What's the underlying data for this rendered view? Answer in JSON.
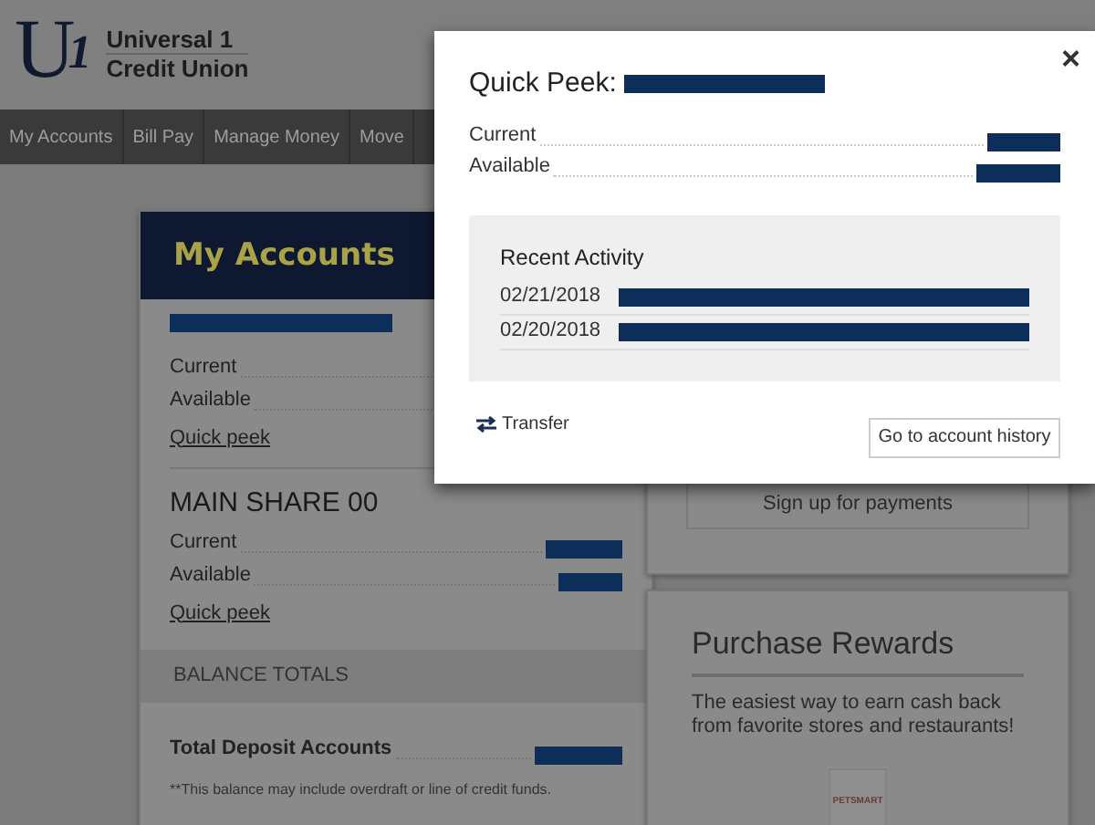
{
  "logo": {
    "mark": "U",
    "mark_sub": "1",
    "line_1": "Universal 1",
    "line_2": "Credit Union"
  },
  "nav": [
    {
      "label": "My Accounts"
    },
    {
      "label": "Bill Pay"
    },
    {
      "label": "Manage Money"
    },
    {
      "label": "Move"
    }
  ],
  "accounts_card": {
    "title": "My Accounts",
    "accounts": [
      {
        "rows": [
          {
            "label": "Current"
          },
          {
            "label": "Available"
          }
        ],
        "link": "Quick peek"
      },
      {
        "name": "MAIN SHARE  00",
        "rows": [
          {
            "label": "Current"
          },
          {
            "label": "Available"
          }
        ],
        "link": "Quick peek"
      }
    ],
    "totals_heading": "BALANCE TOTALS",
    "total_label": "Total Deposit Accounts",
    "footnote": "**This balance may include overdraft or line of credit funds."
  },
  "bill_pay_card": {
    "button": "Sign up for payments"
  },
  "rewards_card": {
    "title": "Purchase Rewards",
    "text": "The easiest way to earn cash back from favorite stores and restaurants!",
    "merchant_logo": "PETSMART"
  },
  "modal": {
    "title": "Quick Peek:",
    "close": "×",
    "rows": [
      {
        "label": "Current"
      },
      {
        "label": "Available"
      }
    ],
    "activity_title": "Recent Activity",
    "activity": [
      {
        "date": "02/21/2018"
      },
      {
        "date": "02/20/2018"
      }
    ],
    "transfer": "Transfer",
    "history_button": "Go to account history"
  }
}
